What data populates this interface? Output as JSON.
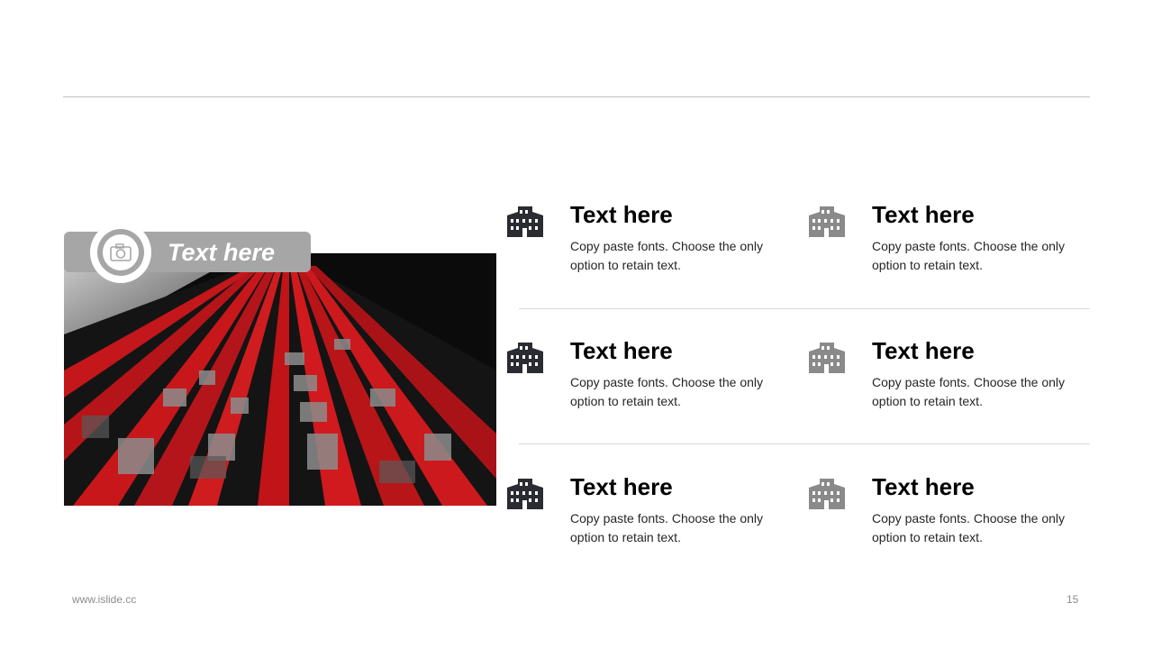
{
  "photo_caption": "Text here",
  "colors": {
    "dark_icon": "#2b2b33",
    "light_icon": "#8a8a8a",
    "tab_gray": "#a6a6a6",
    "accent_red": "#d01818"
  },
  "items": [
    {
      "title": "Text here",
      "desc": "Copy paste fonts. Choose the only option to retain text.",
      "icon": "building-icon"
    },
    {
      "title": "Text here",
      "desc": "Copy paste fonts. Choose the only option to retain text.",
      "icon": "building-icon"
    },
    {
      "title": "Text here",
      "desc": "Copy paste fonts. Choose the only option to retain text.",
      "icon": "building-icon"
    },
    {
      "title": "Text here",
      "desc": "Copy paste fonts. Choose the only option to retain text.",
      "icon": "building-icon"
    },
    {
      "title": "Text here",
      "desc": "Copy paste fonts. Choose the only option to retain text.",
      "icon": "building-icon"
    },
    {
      "title": "Text here",
      "desc": "Copy paste fonts. Choose the only option to retain text.",
      "icon": "building-icon"
    }
  ],
  "footer": {
    "website": "www.islide.cc",
    "page_number": "15"
  }
}
